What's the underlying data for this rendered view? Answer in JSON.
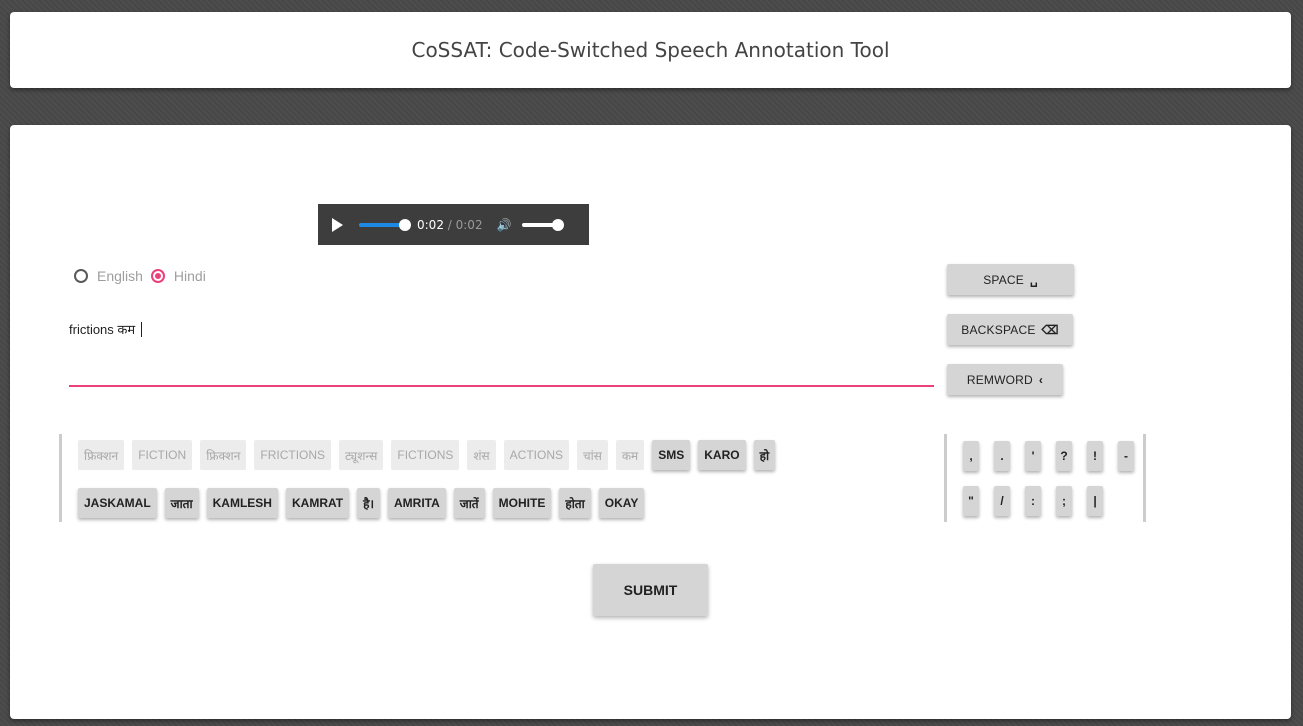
{
  "header": {
    "title": "CoSSAT: Code-Switched Speech Annotation Tool"
  },
  "audio": {
    "current_time": "0:02",
    "separator": " / ",
    "duration": "0:02",
    "progress_fraction": 1.0,
    "volume_fraction": 1.0
  },
  "language": {
    "options": [
      "English",
      "Hindi"
    ],
    "selected": "Hindi"
  },
  "transcript": {
    "value": "frictions कम "
  },
  "actions": {
    "space_label": "SPACE",
    "backspace_label": "BACKSPACE",
    "remword_label": "REMWORD"
  },
  "suggestions": {
    "row1": [
      {
        "text": "फ्रिक्शन",
        "enabled": false
      },
      {
        "text": "FICTION",
        "enabled": false
      },
      {
        "text": "फ्रिक्शन",
        "enabled": false
      },
      {
        "text": "FRICTIONS",
        "enabled": false
      },
      {
        "text": "ट्यूशन्स",
        "enabled": false
      },
      {
        "text": "FICTIONS",
        "enabled": false
      },
      {
        "text": "शंस",
        "enabled": false
      },
      {
        "text": "ACTIONS",
        "enabled": false
      },
      {
        "text": "चांस",
        "enabled": false
      },
      {
        "text": "कम",
        "enabled": false
      },
      {
        "text": "SMS",
        "enabled": true
      },
      {
        "text": "KARO",
        "enabled": true
      },
      {
        "text": "हो",
        "enabled": true
      }
    ],
    "row2": [
      {
        "text": "JASKAMAL",
        "enabled": true
      },
      {
        "text": "जाता",
        "enabled": true
      },
      {
        "text": "KAMLESH",
        "enabled": true
      },
      {
        "text": "KAMRAT",
        "enabled": true
      },
      {
        "text": "है।",
        "enabled": true
      },
      {
        "text": "AMRITA",
        "enabled": true
      },
      {
        "text": "जातें",
        "enabled": true
      },
      {
        "text": "MOHITE",
        "enabled": true
      },
      {
        "text": "होता",
        "enabled": true
      },
      {
        "text": "OKAY",
        "enabled": true
      }
    ]
  },
  "punctuation": {
    "row1": [
      ",",
      ".",
      "'",
      "?",
      "!",
      "-"
    ],
    "row2": [
      "\"",
      "/",
      ":",
      ";",
      "|"
    ]
  },
  "submit_label": "SUBMIT",
  "colors": {
    "accent": "#ec407a",
    "seek": "#1e88e5"
  }
}
